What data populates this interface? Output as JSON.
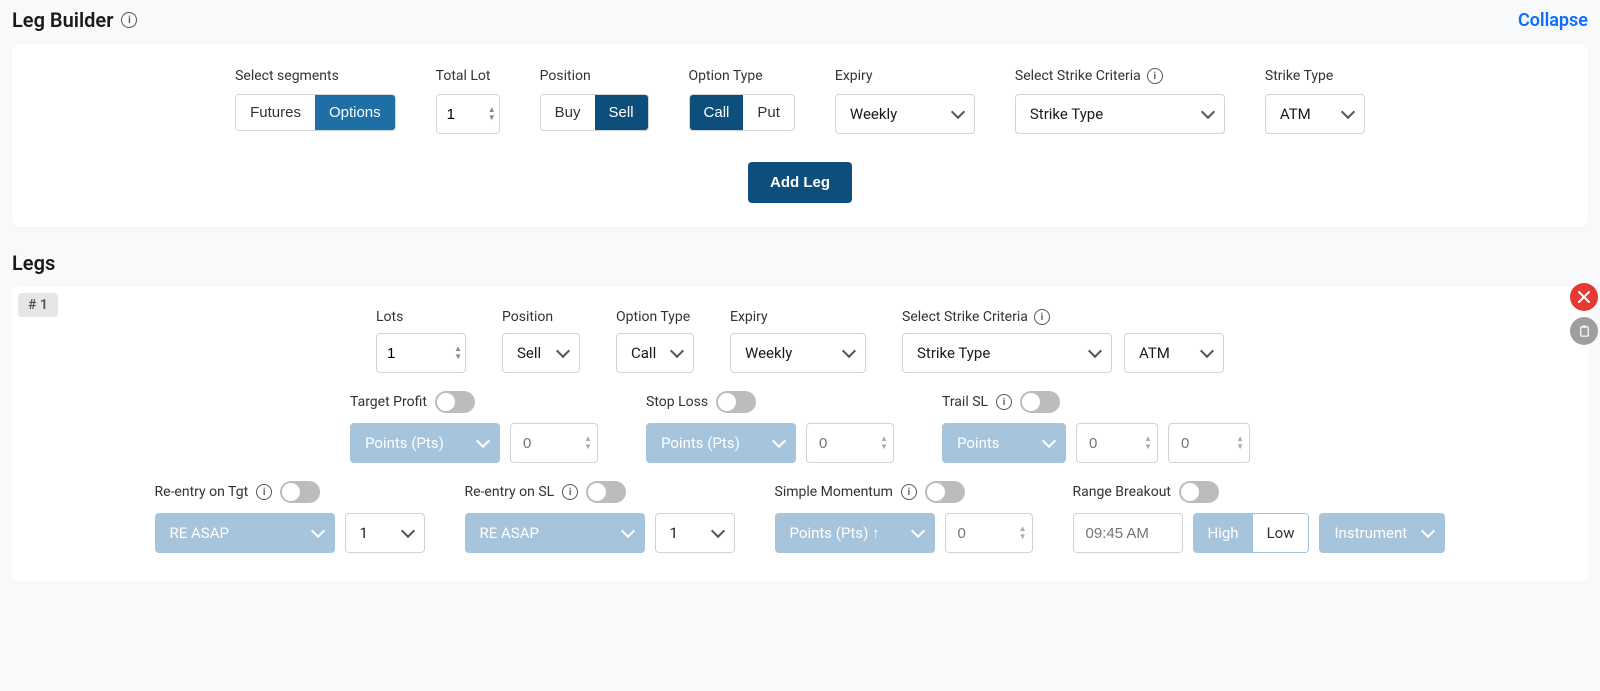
{
  "header": {
    "title": "Leg Builder",
    "collapse_label": "Collapse"
  },
  "builder": {
    "segments_label": "Select segments",
    "segments": {
      "futures": "Futures",
      "options": "Options"
    },
    "total_lot_label": "Total Lot",
    "total_lot_value": "1",
    "position_label": "Position",
    "position": {
      "buy": "Buy",
      "sell": "Sell"
    },
    "option_type_label": "Option Type",
    "option_type": {
      "call": "Call",
      "put": "Put"
    },
    "expiry_label": "Expiry",
    "expiry_value": "Weekly",
    "strike_criteria_label": "Select Strike Criteria",
    "strike_criteria_value": "Strike Type",
    "strike_type_label": "Strike Type",
    "strike_type_value": "ATM",
    "add_leg_label": "Add Leg"
  },
  "legs_title": "Legs",
  "leg1": {
    "badge": "# 1",
    "lots_label": "Lots",
    "lots_value": "1",
    "position_label": "Position",
    "position_value": "Sell",
    "option_type_label": "Option Type",
    "option_type_value": "Call",
    "expiry_label": "Expiry",
    "expiry_value": "Weekly",
    "strike_criteria_label": "Select Strike Criteria",
    "strike_criteria_value": "Strike Type",
    "strike_type_value": "ATM",
    "target_profit_label": "Target Profit",
    "tp_unit": "Points (Pts)",
    "tp_value": "0",
    "stop_loss_label": "Stop Loss",
    "sl_unit": "Points (Pts)",
    "sl_value": "0",
    "trail_sl_label": "Trail SL",
    "trail_unit": "Points",
    "trail_v1": "0",
    "trail_v2": "0",
    "reentry_tgt_label": "Re-entry on Tgt",
    "reentry_tgt_mode": "RE ASAP",
    "reentry_tgt_count": "1",
    "reentry_sl_label": "Re-entry on SL",
    "reentry_sl_mode": "RE ASAP",
    "reentry_sl_count": "1",
    "simple_momentum_label": "Simple Momentum",
    "sm_unit": "Points (Pts) ↑",
    "sm_value": "0",
    "range_breakout_label": "Range Breakout",
    "rb_time": "09:45 AM",
    "rb_high": "High",
    "rb_low": "Low",
    "rb_instrument": "Instrument"
  }
}
